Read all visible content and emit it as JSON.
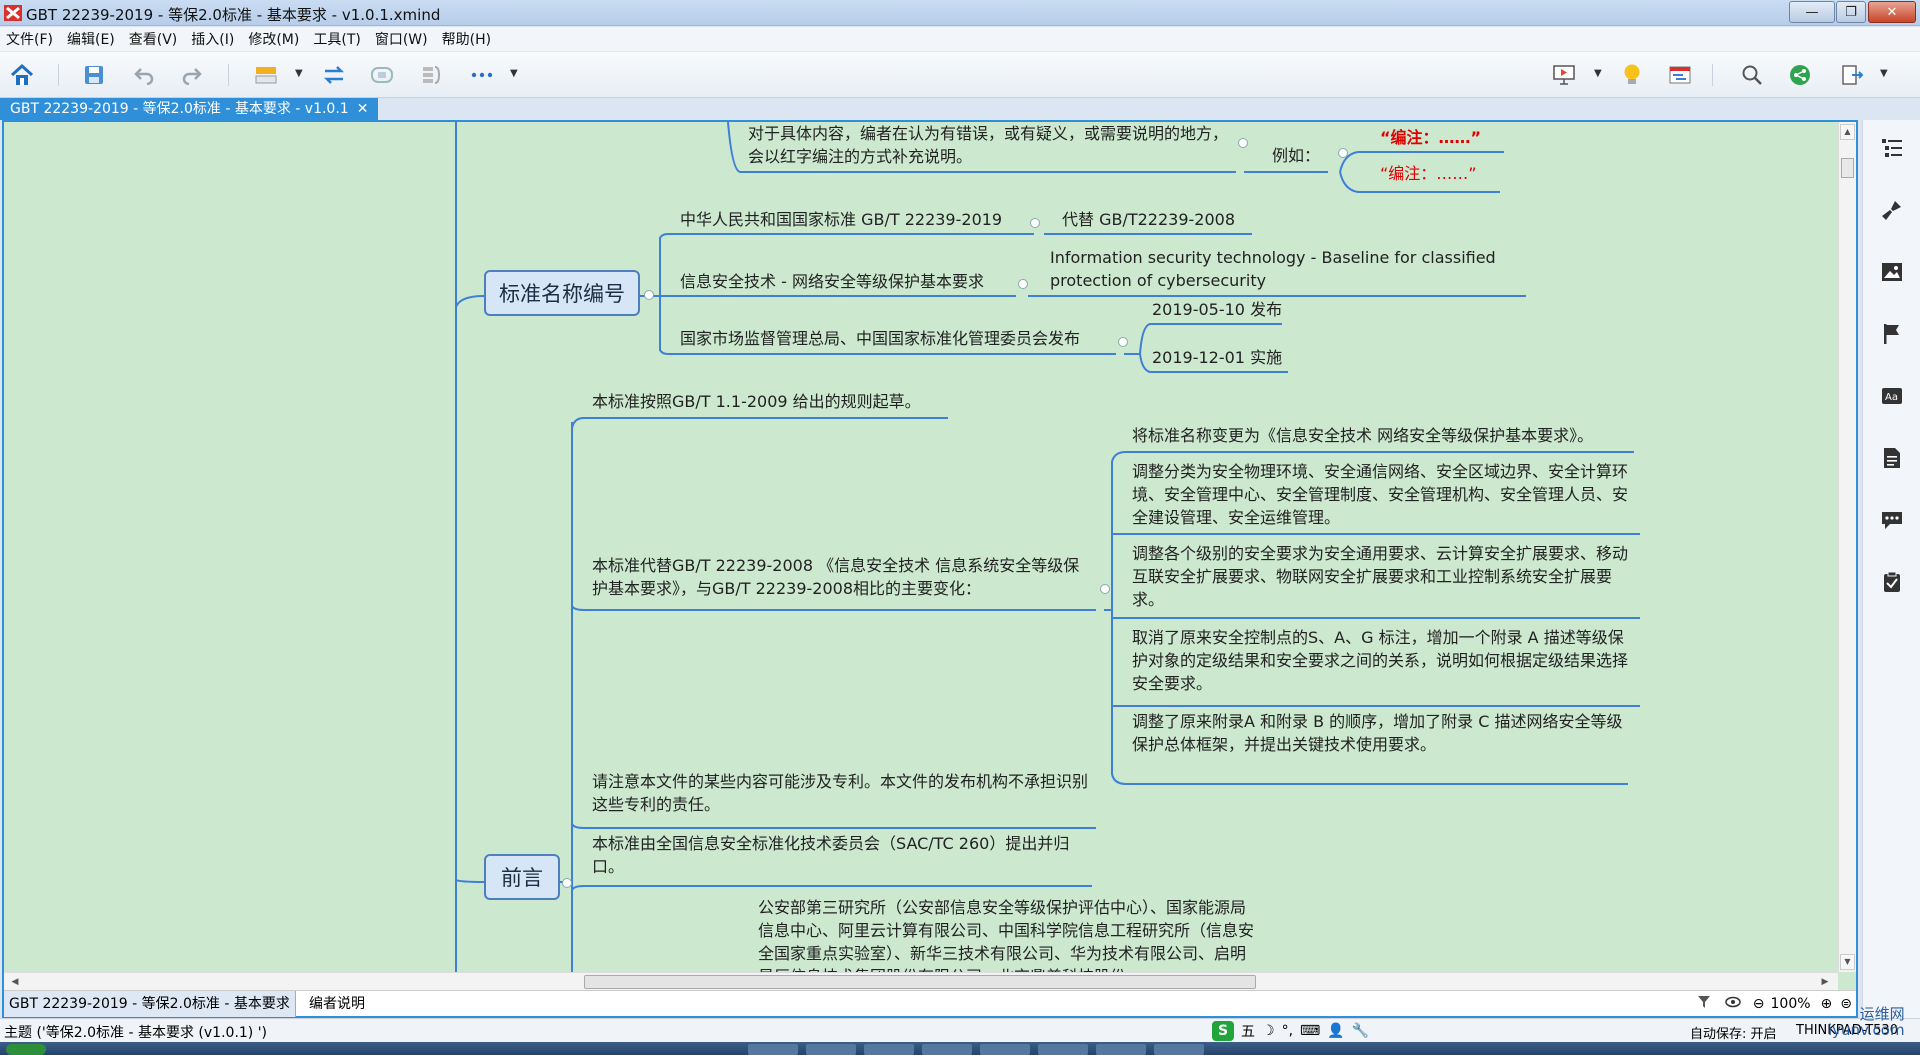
{
  "window": {
    "title": "GBT 22239-2019 - 等保2.0标准 - 基本要求 - v1.0.1.xmind",
    "minimize": "—",
    "maximize": "❐",
    "close": "✕"
  },
  "menu": [
    "文件(F)",
    "编辑(E)",
    "查看(V)",
    "插入(I)",
    "修改(M)",
    "工具(T)",
    "窗口(W)",
    "帮助(H)"
  ],
  "doc_tab": {
    "label": "GBT 22239-2019 - 等保2.0标准 - 基本要求 - v1.0.1",
    "close": "✕"
  },
  "map": {
    "note": {
      "text": "对于具体内容，编者在认为有错误，或有疑义，或需要说明的地方，会以红字编注的方式补充说明。",
      "example_label": "例如：",
      "example_bold": "“编注：……”",
      "example_plain": "“编注：……”"
    },
    "standard_topic": {
      "title": "标准名称编号",
      "national": "中华人民共和国国家标准 GB/T 22239-2019",
      "replaces": "代替 GB/T22239-2008",
      "cn_name": "信息安全技术 - 网络安全等级保护基本要求",
      "en_name": "Information security technology  - Baseline for classified protection of cybersecurity",
      "publisher": "国家市场监督管理总局、中国国家标准化管理委员会发布",
      "published": "2019-05-10 发布",
      "effective": "2019-12-01 实施"
    },
    "preface_topic": {
      "title": "前言",
      "drafted": "本标准按照GB/T 1.1-2009 给出的规则起草。",
      "replaces": "本标准代替GB/T 22239-2008 《信息安全技术 信息系统安全等级保护基本要求》，与GB/T 22239-2008相比的主要变化：",
      "changes": [
        "将标准名称变更为《信息安全技术 网络安全等级保护基本要求》。",
        "调整分类为安全物理环境、安全通信网络、安全区域边界、安全计算环境、安全管理中心、安全管理制度、安全管理机构、安全管理人员、安全建设管理、安全运维管理。",
        "调整各个级别的安全要求为安全通用要求、云计算安全扩展要求、移动互联安全扩展要求、物联网安全扩展要求和工业控制系统安全扩展要求。",
        "取消了原来安全控制点的S、A、G 标注，增加一个附录 A 描述等级保护对象的定级结果和安全要求之间的关系，说明如何根据定级结果选择安全要求。",
        "调整了原来附录A 和附录 B 的顺序，增加了附录 C 描述网络安全等级保护总体框架，并提出关键技术使用要求。"
      ],
      "patent": "请注意本文件的某些内容可能涉及专利。本文件的发布机构不承担识别这些专利的责任。",
      "proposed": "本标准由全国信息安全标准化技术委员会（SAC/TC 260）提出并归口。",
      "drafters": "公安部第三研究所（公安部信息安全等级保护评估中心）、国家能源局信息中心、阿里云计算有限公司、中国科学院信息工程研究所（信息安全国家重点实验室）、新华三技术有限公司、华为技术有限公司、启明星辰信息技术集团股份有限公司、北京鼎普科技股份"
    }
  },
  "sheets": [
    "GBT 22239-2019 - 等保2.0标准 - 基本要求",
    "编者说明"
  ],
  "zoom": "100%",
  "status": {
    "topic": "主题 ('等保2.0标准 - 基本要求 (v1.0.1) ')",
    "ime_char": "五",
    "autosave": "自动保存: 开启",
    "machine": "THINKPAD-T530"
  },
  "watermark": {
    "line1": "运维网",
    "line2": "iyunv.com"
  },
  "colors": {
    "canvas": "#cce8cf",
    "accent": "#2f8fd8",
    "branch": "#3f7fd8",
    "red_note": "#e00000"
  }
}
